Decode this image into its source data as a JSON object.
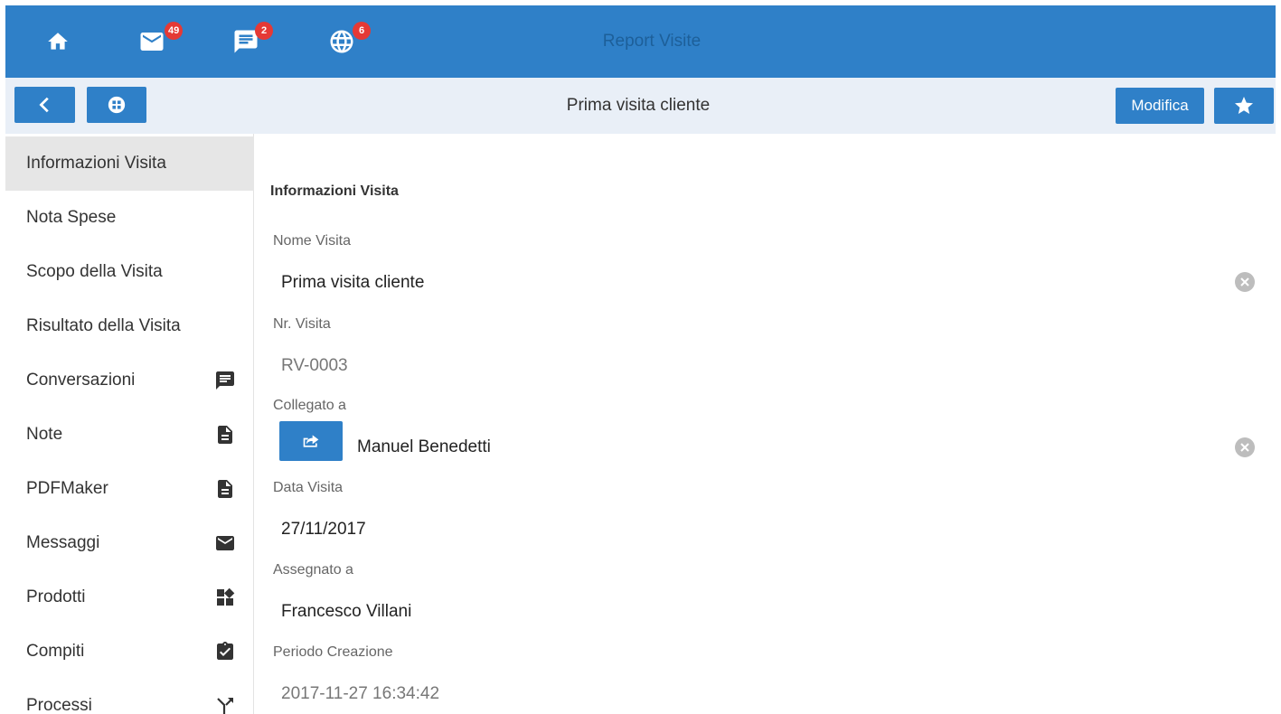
{
  "header": {
    "app_title": "Report Visite",
    "icons": [
      {
        "name": "home-icon"
      },
      {
        "name": "mail-icon",
        "badge": "49"
      },
      {
        "name": "chat-icon",
        "badge": "2"
      },
      {
        "name": "globe-icon",
        "badge": "6"
      }
    ]
  },
  "toolbar": {
    "back_icon": "chevron-left-icon",
    "menu_icon": "grid-circle-icon",
    "page_title": "Prima visita cliente",
    "edit_label": "Modifica",
    "favorite_icon": "star-icon"
  },
  "sidebar": {
    "items": [
      {
        "label": "Informazioni Visita",
        "icon": null,
        "active": true
      },
      {
        "label": "Nota Spese",
        "icon": null
      },
      {
        "label": "Scopo della Visita",
        "icon": null
      },
      {
        "label": "Risultato della Visita",
        "icon": null
      },
      {
        "label": "Conversazioni",
        "icon": "chat-icon"
      },
      {
        "label": "Note",
        "icon": "document-icon"
      },
      {
        "label": "PDFMaker",
        "icon": "document-icon"
      },
      {
        "label": "Messaggi",
        "icon": "mail-icon"
      },
      {
        "label": "Prodotti",
        "icon": "widgets-icon"
      },
      {
        "label": "Compiti",
        "icon": "clipboard-check-icon"
      },
      {
        "label": "Processi",
        "icon": "merge-icon"
      }
    ]
  },
  "main": {
    "section_title": "Informazioni Visita",
    "fields": {
      "nome_visita": {
        "label": "Nome Visita",
        "value": "Prima visita cliente"
      },
      "nr_visita": {
        "label": "Nr. Visita",
        "value": "RV-0003"
      },
      "collegato_a": {
        "label": "Collegato a",
        "value": "Manuel Benedetti"
      },
      "data_visita": {
        "label": "Data Visita",
        "value": "27/11/2017"
      },
      "assegnato_a": {
        "label": "Assegnato a",
        "value": "Francesco Villani"
      },
      "periodo_creazione": {
        "label": "Periodo Creazione",
        "value": "2017-11-27 16:34:42"
      }
    }
  },
  "colors": {
    "primary": "#2f80c8",
    "badge": "#e53935",
    "subbar_bg": "#e9eff7",
    "active_item_bg": "#e6e6e6"
  }
}
